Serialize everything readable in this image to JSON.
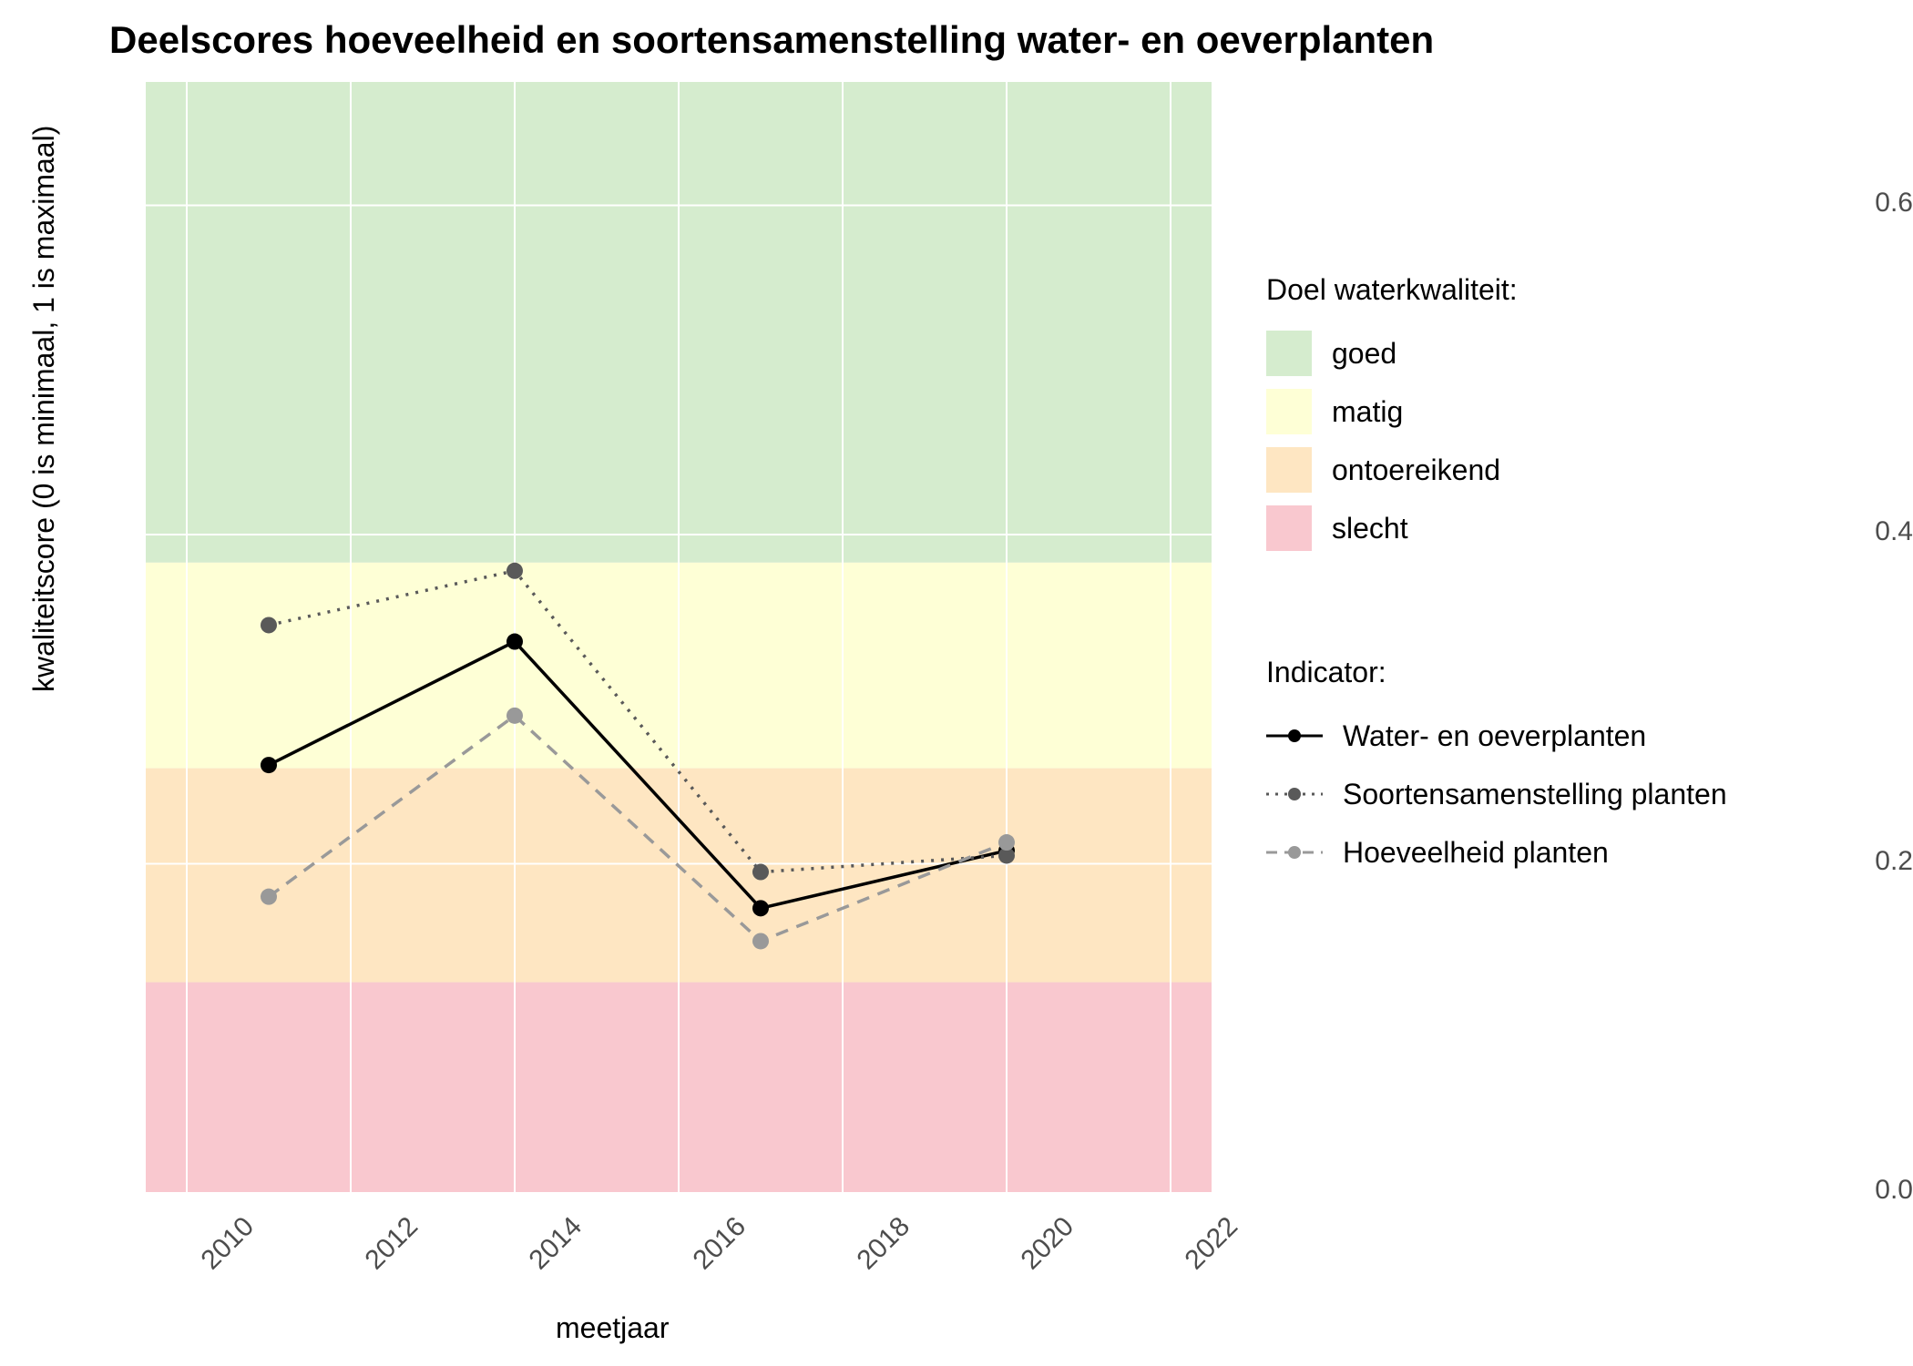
{
  "chart_data": {
    "type": "line",
    "title": "Deelscores hoeveelheid en soortensamenstelling water- en oeverplanten",
    "xlabel": "meetjaar",
    "ylabel": "kwaliteitscore (0 is minimaal, 1 is maximaal)",
    "x_ticks": [
      2010,
      2012,
      2014,
      2016,
      2018,
      2020,
      2022
    ],
    "y_ticks": [
      0.0,
      0.2,
      0.4,
      0.6
    ],
    "xlim": [
      2009.5,
      2022.5
    ],
    "ylim": [
      0.0,
      0.675
    ],
    "x": [
      2011,
      2014,
      2017,
      2020
    ],
    "series": [
      {
        "name": "Water- en oeverplanten",
        "linestyle": "solid",
        "color": "#000000",
        "values": [
          0.26,
          0.335,
          0.173,
          0.208
        ]
      },
      {
        "name": "Soortensamenstelling planten",
        "linestyle": "dotted",
        "color": "#595959",
        "values": [
          0.345,
          0.378,
          0.195,
          0.205
        ]
      },
      {
        "name": "Hoeveelheid planten",
        "linestyle": "dashed",
        "color": "#999999",
        "values": [
          0.18,
          0.29,
          0.153,
          0.213
        ]
      }
    ],
    "bands": {
      "title": "Doel waterkwaliteit:",
      "items": [
        {
          "label": "goed",
          "color": "#d5ecce",
          "from": 0.383,
          "to": 0.675
        },
        {
          "label": "matig",
          "color": "#feffd6",
          "from": 0.258,
          "to": 0.383
        },
        {
          "label": "ontoereikend",
          "color": "#fee6c2",
          "from": 0.128,
          "to": 0.258
        },
        {
          "label": "slecht",
          "color": "#f9c8cf",
          "from": 0.0,
          "to": 0.128
        }
      ]
    }
  },
  "legend1_title": "Doel waterkwaliteit:",
  "legend1": {
    "a": "goed",
    "b": "matig",
    "c": "ontoereikend",
    "d": "slecht"
  },
  "legend2_title": "Indicator:",
  "legend2": {
    "a": "Water- en oeverplanten",
    "b": "Soortensamenstelling planten",
    "c": "Hoeveelheid planten"
  },
  "yTicks": {
    "t0": "0.0",
    "t1": "0.2",
    "t2": "0.4",
    "t3": "0.6"
  },
  "xTicks": {
    "t0": "2010",
    "t1": "2012",
    "t2": "2014",
    "t3": "2016",
    "t4": "2018",
    "t5": "2020",
    "t6": "2022"
  }
}
